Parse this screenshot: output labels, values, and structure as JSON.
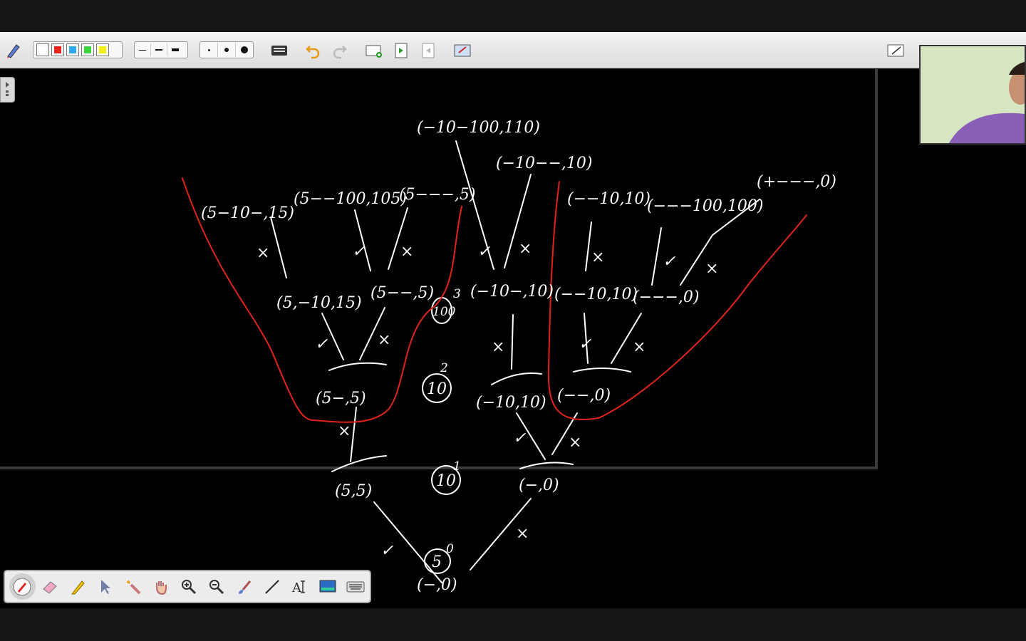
{
  "toolbar": {
    "colors": [
      "#ffffff",
      "#e8231a",
      "#2fa9ef",
      "#3cd33c",
      "#f2ee10"
    ],
    "line_widths": [
      "thin",
      "medium",
      "thick"
    ],
    "dot_sizes": [
      "small",
      "medium",
      "large"
    ],
    "icons": [
      "keyboard-icon",
      "undo-icon",
      "redo-icon",
      "add-page-icon",
      "next-page-icon",
      "previous-page-icon",
      "screen-capture-icon",
      "whiteboard-icon"
    ]
  },
  "pen_toolbar": {
    "tools": [
      "pen",
      "eraser",
      "highlighter",
      "pointer",
      "magic-select",
      "pan",
      "zoom-in",
      "zoom-out",
      "brush",
      "line",
      "text",
      "screen",
      "keyboard"
    ]
  },
  "board": {
    "nodes": {
      "root": "(−,0)",
      "l1_left": "(5,5)",
      "l1_right": "(−,0)",
      "l2_a": "(5−,5)",
      "l2_b": "(−10,10)",
      "l2_c": "(−−,0)",
      "l3_a": "(5,−10,15)",
      "l3_b": "(5−−,5)",
      "l3_c": "(−10−,10)",
      "l3_d": "(−−10,10)",
      "l3_e": "(−−−,0)",
      "l4_a": "(5−10−,15)",
      "l4_b": "(5−−100,105)",
      "l4_c": "(5−−−,5)",
      "l4_d": "(−10−100,110)",
      "l4_e": "(−10−−,10)",
      "l4_f": "(−−10,10)",
      "l4_g": "(−−−100,100)",
      "l4_h": "(+−−−,0)"
    },
    "circled": [
      "100",
      "10",
      "10",
      "5"
    ],
    "superscripts": [
      "3",
      "2",
      "1",
      "0"
    ],
    "marks": {
      "check": "✓",
      "cross": "×"
    }
  }
}
